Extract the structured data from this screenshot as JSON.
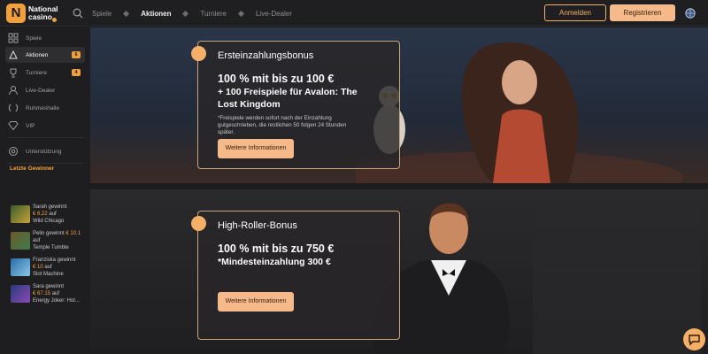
{
  "header": {
    "logo_text": "National\ncasino",
    "logo_letter": "N",
    "nav": [
      {
        "label": "Spiele",
        "active": false
      },
      {
        "label": "Aktionen",
        "active": true
      },
      {
        "label": "Turniere",
        "active": false
      },
      {
        "label": "Live-Dealer",
        "active": false
      }
    ],
    "login_label": "Anmelden",
    "register_label": "Registrieren"
  },
  "sidebar": {
    "items": [
      {
        "label": "Spiele",
        "icon": "games-icon"
      },
      {
        "label": "Aktionen",
        "icon": "promotions-icon",
        "badge": "6",
        "active": true
      },
      {
        "label": "Turniere",
        "icon": "tournaments-icon",
        "badge": "4"
      },
      {
        "label": "Live-Dealer",
        "icon": "live-dealer-icon"
      },
      {
        "label": "Ruhmeshalle",
        "icon": "laurel-icon"
      },
      {
        "label": "VIP",
        "icon": "diamond-icon"
      },
      {
        "label": "Unterstützung",
        "icon": "support-icon"
      }
    ],
    "winners_title": "Letzte Gewinner",
    "winners": [
      {
        "name": "Sarah gewinnt",
        "amount": "€ 6.22",
        "suffix": "auf",
        "game": "Wild Chicago"
      },
      {
        "name": "Pelin gewinnt",
        "amount": "€ 10.1",
        "suffix": "auf",
        "game": "Temple Tumble"
      },
      {
        "name": "Franziska gewinnt",
        "amount": "€ 10",
        "suffix": "auf",
        "game": "Slot Machine"
      },
      {
        "name": "Sara gewinnt",
        "amount": "€ 67.15",
        "suffix": "auf",
        "game": "Energy Joker: Hol..."
      }
    ]
  },
  "promos": [
    {
      "title": "Ersteinzahlungsbonus",
      "headline": "100 % mit bis zu 100 €",
      "sub": "+ 100 Freispiele für Avalon: The Lost Kingdom",
      "note": "*Freispiele werden sofort nach der Einzahlung gutgeschrieben, die restlichen 50 folgen 24 Stunden später.",
      "button": "Weitere Informationen"
    },
    {
      "title": "High-Roller-Bonus",
      "headline": "100 % mit bis zu 750 €",
      "sub": "*Mindesteinzahlung 300 €",
      "button": "Weitere Informationen"
    }
  ],
  "colors": {
    "accent": "#f2a03d",
    "button": "#f6b98a",
    "background": "#1c1c1e"
  }
}
